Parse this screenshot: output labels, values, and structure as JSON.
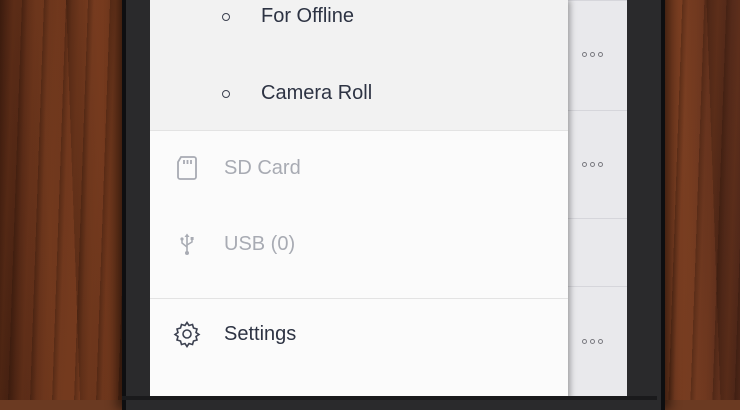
{
  "menu": {
    "sub_items": [
      {
        "label": "For Offline"
      },
      {
        "label": "Camera Roll"
      }
    ],
    "items": [
      {
        "label": "SD Card",
        "icon": "sd-card-icon",
        "enabled": false
      },
      {
        "label": "USB (0)",
        "icon": "usb-icon",
        "enabled": false
      },
      {
        "label": "Settings",
        "icon": "gear-icon",
        "enabled": true
      }
    ]
  },
  "background_list": {
    "row_action_icon": "more-dots-icon"
  },
  "colors": {
    "text_primary": "#2d3343",
    "text_disabled": "#a8abb3",
    "drawer_bg": "#f7f7f7"
  }
}
